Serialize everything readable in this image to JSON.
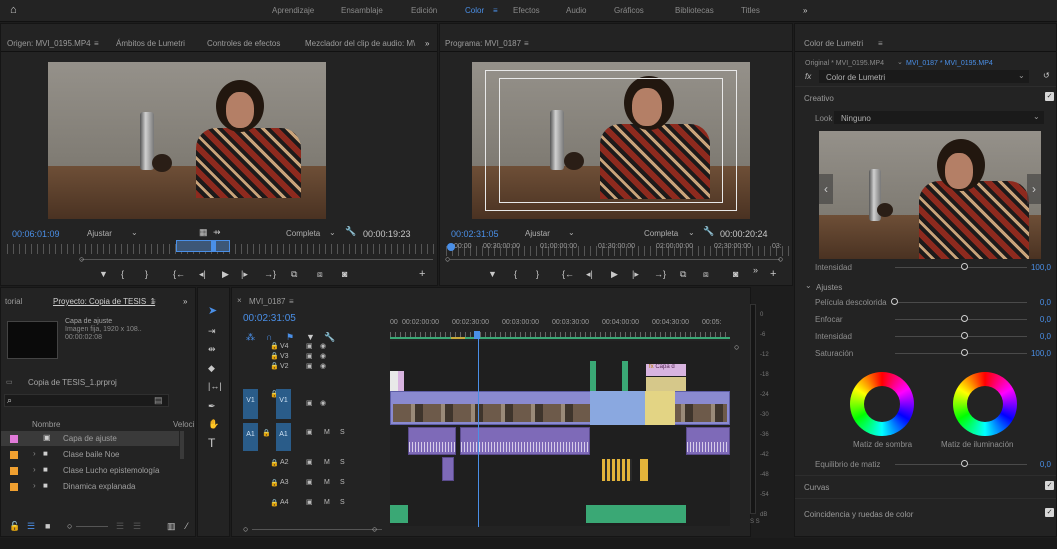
{
  "workspaces": {
    "home_icon": "home-icon",
    "items": [
      "Aprendizaje",
      "Ensamblaje",
      "Edición",
      "Color",
      "Efectos",
      "Audio",
      "Gráficos",
      "Bibliotecas",
      "Titles"
    ],
    "active": "Color",
    "menu_icon": "≡",
    "more": "»"
  },
  "source_monitor": {
    "tabs": [
      "Origen: MVI_0195.MP4",
      "Ámbitos de Lumetri",
      "Controles de efectos",
      "Mezclador del clip de audio: M\\"
    ],
    "menu": "≡",
    "more": "»",
    "timecode": "00:06:01:09",
    "fit": "Ajustar",
    "quality": "Completa",
    "duration": "00:00:19:23"
  },
  "program_monitor": {
    "title": "Programa: MVI_0187",
    "menu": "≡",
    "timecode": "00:02:31:05",
    "fit": "Ajustar",
    "quality": "Completa",
    "duration": "00:00:20:24",
    "ruler": [
      "00:00",
      "00:30:00:00",
      "01:00:00:00",
      "01:30:00:00",
      "02:00:00:00",
      "02:30:00:00",
      "03:"
    ]
  },
  "project": {
    "tabs": [
      "torial",
      "Proyecto: Copia de TESIS_1"
    ],
    "menu": "≡",
    "more": "»",
    "preview_name": "Capa de ajuste",
    "preview_info": "Imagen fija, 1920 x 108..",
    "preview_time": "00:00:02:08",
    "file": "Copia de TESIS_1.prproj",
    "search_placeholder": "",
    "col_name": "Nombre",
    "col_speed": "Veloci",
    "items": [
      {
        "name": "Capa de ajuste",
        "color": "#e07ad8",
        "selected": true
      },
      {
        "name": "Clase baile Noe",
        "color": "#f0a030",
        "selected": false
      },
      {
        "name": "Clase Lucho epistemología",
        "color": "#f0a030",
        "selected": false
      },
      {
        "name": "Dinamica explanada",
        "color": "#f0a030",
        "selected": false
      }
    ]
  },
  "timeline": {
    "tab": "MVI_0187",
    "menu": "≡",
    "close": "×",
    "timecode": "00:02:31:05",
    "ruler": [
      "00",
      "00:02:00:00",
      "00:02:30:00",
      "00:03:00:00",
      "00:03:30:00",
      "00:04:00:00",
      "00:04:30:00",
      "00:05:"
    ],
    "tracks_video": [
      "V4",
      "V3",
      "V2",
      "V1"
    ],
    "tracks_audio": [
      "A1",
      "A2",
      "A3",
      "A4"
    ],
    "source_patch_v": "V1",
    "source_patch_a": "A1",
    "mute": "M",
    "solo": "S",
    "capa_label": "Capa d",
    "meter_scale": [
      "0",
      "-6",
      "-12",
      "-18",
      "-24",
      "-30",
      "-36",
      "-42",
      "-48",
      "-54",
      "dB"
    ],
    "meter_bottom": "S S"
  },
  "lumetri": {
    "title": "Color de Lumetri",
    "menu": "≡",
    "more": "»",
    "source": "Original * MVI_0195.MP4",
    "sequence": "MVI_0187 * MVI_0195.MP4",
    "fx_label": "Color de Lumetri",
    "creativo": "Creativo",
    "look_label": "Look",
    "look_value": "Ninguno",
    "intensity_label": "Intensidad",
    "intensity_value": "100,0",
    "ajustes": "Ajustes",
    "sliders": [
      {
        "label": "Película descolorida",
        "value": "0,0"
      },
      {
        "label": "Enfocar",
        "value": "0,0"
      },
      {
        "label": "Intensidad",
        "value": "0,0"
      },
      {
        "label": "Saturación",
        "value": "100,0"
      }
    ],
    "wheel_shadow": "Matiz de sombra",
    "wheel_highlight": "Matiz de iluminación",
    "balance_label": "Equilibrio de matiz",
    "balance_value": "0,0",
    "curvas": "Curvas",
    "coincidencia": "Coincidencia y ruedas de color"
  }
}
